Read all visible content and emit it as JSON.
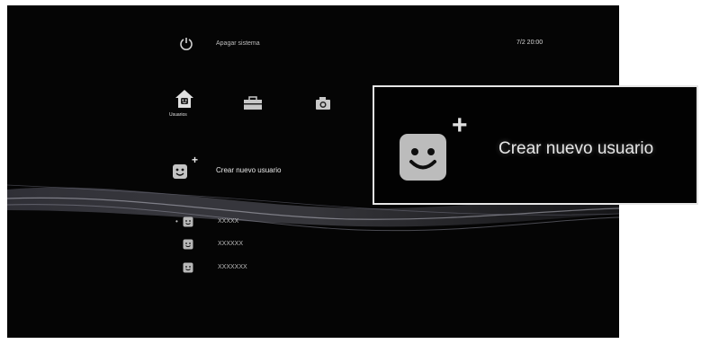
{
  "system": {
    "power_label": "Apagar sistema",
    "clock": "7/2 20:00"
  },
  "categories": [
    {
      "id": "users",
      "icon": "house-user-icon",
      "label": "Usuarios",
      "selected": true
    },
    {
      "id": "settings",
      "icon": "toolbox-icon",
      "label": ""
    },
    {
      "id": "photo",
      "icon": "camera-icon",
      "label": ""
    }
  ],
  "menu": {
    "create_user_label": "Crear nuevo usuario",
    "users": [
      {
        "name": "XXXXX"
      },
      {
        "name": "XXXXXX"
      },
      {
        "name": "XXXXXXX"
      }
    ]
  },
  "zoom": {
    "label": "Crear nuevo usuario"
  },
  "colors": {
    "background": "#050505",
    "wave": "#8a8a9a",
    "text": "#d0d0d0",
    "callout_border": "#e6e6e6"
  }
}
